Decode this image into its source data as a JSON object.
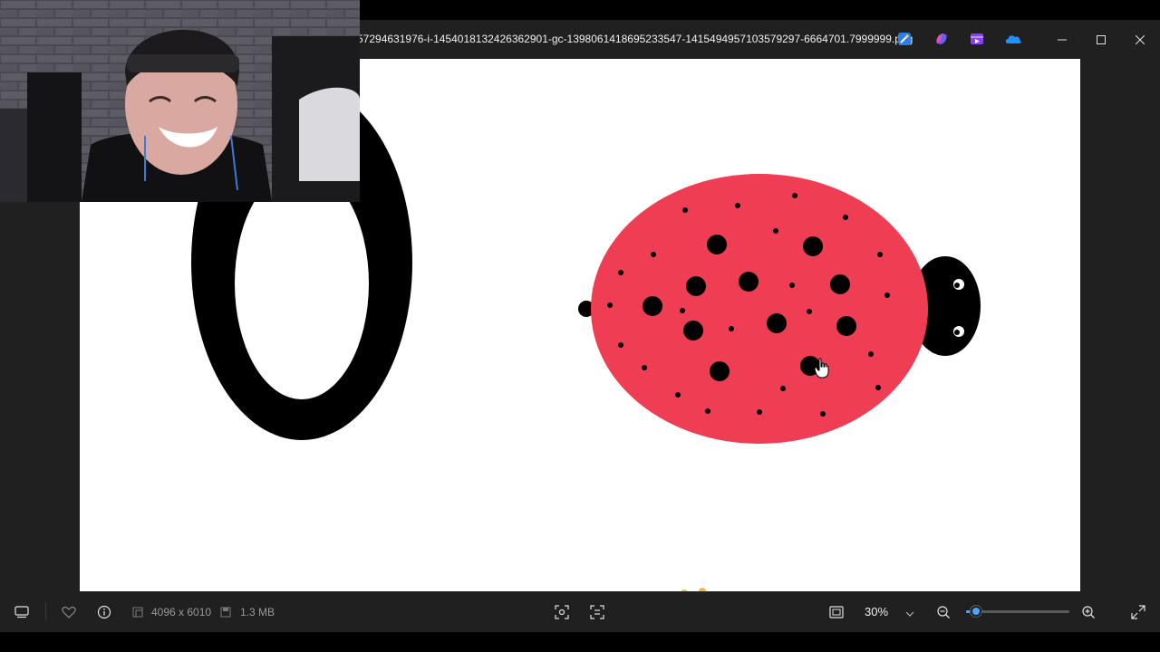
{
  "titlebar": {
    "filename": "57294631976-i-1454018132426362901-gc-1398061418695233547-1415494957103579297-6664701.7999999.png",
    "app_icons": [
      "designer-icon",
      "copilot-icon",
      "clipchamp-icon",
      "onedrive-icon"
    ]
  },
  "window_controls": [
    "minimize-icon",
    "maximize-icon",
    "close-icon"
  ],
  "footer": {
    "dimensions": "4096 x 6010",
    "file_size": "1.3 MB",
    "zoom_level": "30%",
    "zoom_fraction": 0.1
  },
  "colors": {
    "ladybug_body": "#ef3e54",
    "chrome_bg": "#202020",
    "accent": "#4da3ff"
  }
}
